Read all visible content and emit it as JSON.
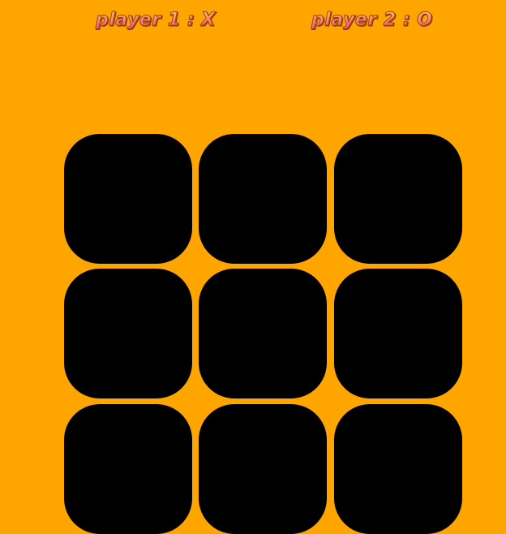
{
  "players": {
    "player1": "player 1 : X",
    "player2": "player 2 : O"
  },
  "colors": {
    "background": "#FFA500",
    "cell": "#000000",
    "label_gradient_top": "#FFD84A",
    "label_gradient_bottom": "#FF2FA8"
  },
  "board": {
    "rows": 3,
    "cols": 3,
    "cells": [
      "",
      "",
      "",
      "",
      "",
      "",
      "",
      "",
      ""
    ]
  }
}
